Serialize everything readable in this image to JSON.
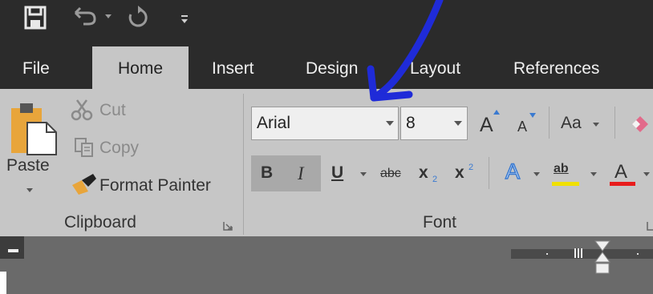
{
  "colors": {
    "titlebar": "#2b2b2b",
    "ribbon": "#c6c6c6",
    "annotation": "#1f2bd8",
    "highlight": "#f0e000",
    "font_color": "#e81c1c"
  },
  "qat": {
    "icons": [
      "save-icon",
      "undo-icon",
      "redo-icon",
      "customize-icon"
    ]
  },
  "tabs": {
    "file": "File",
    "home": "Home",
    "insert": "Insert",
    "design": "Design",
    "layout": "Layout",
    "references": "References"
  },
  "clipboard": {
    "paste": "Paste",
    "cut": "Cut",
    "copy": "Copy",
    "format_painter": "Format Painter",
    "group": "Clipboard"
  },
  "font": {
    "name": "Arial",
    "size": "8",
    "grow": "A",
    "shrink": "A",
    "change_case": "Aa",
    "bold": "B",
    "italic": "I",
    "underline": "U",
    "strike": "abc",
    "subscript": "x",
    "subscript_mark": "2",
    "superscript": "x",
    "superscript_mark": "2",
    "effects": "A",
    "highlight": "ab",
    "color": "A",
    "group": "Font"
  }
}
